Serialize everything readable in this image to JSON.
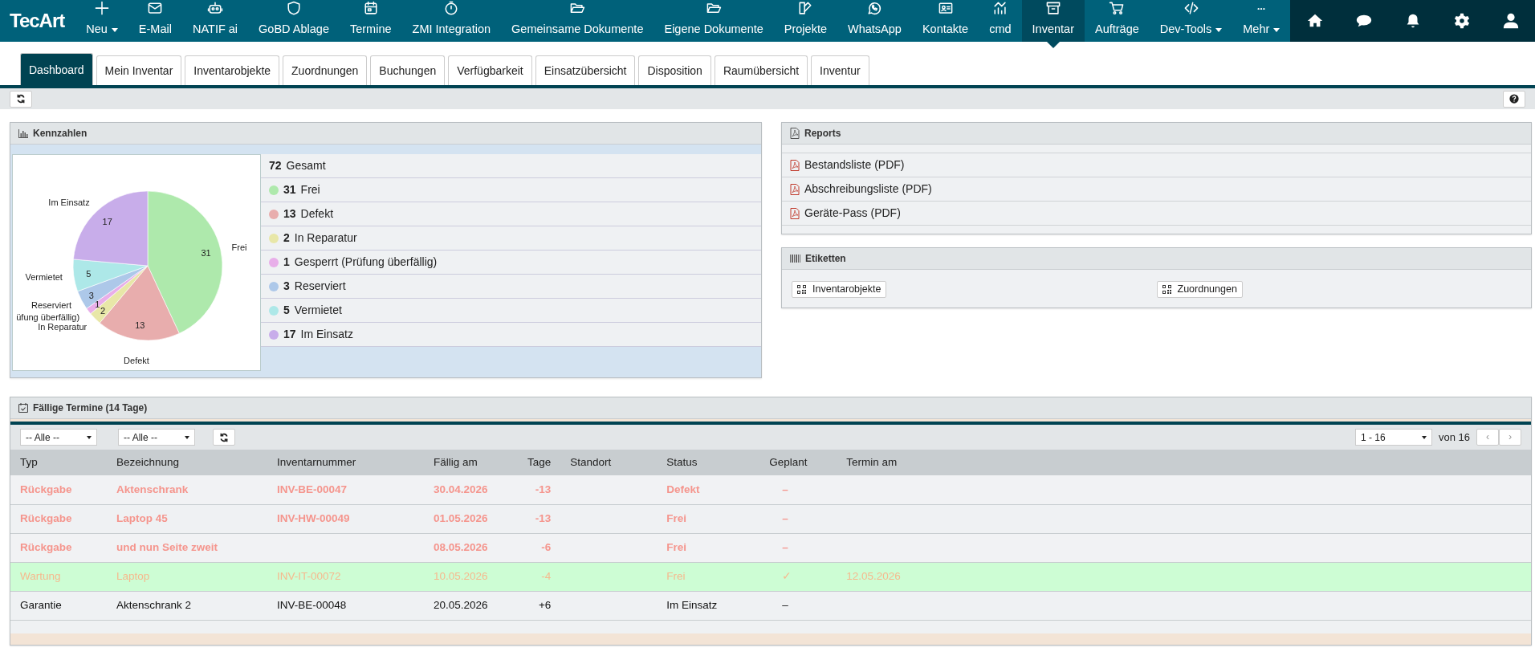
{
  "brand": {
    "name": "TecArt"
  },
  "nav": [
    {
      "label": "Neu",
      "dropdown": true,
      "selected": false
    },
    {
      "label": "E-Mail",
      "dropdown": false,
      "selected": false
    },
    {
      "label": "NATIF ai",
      "dropdown": false,
      "selected": false
    },
    {
      "label": "GoBD Ablage",
      "dropdown": false,
      "selected": false
    },
    {
      "label": "Termine",
      "dropdown": false,
      "selected": false
    },
    {
      "label": "ZMI Integration",
      "dropdown": false,
      "selected": false
    },
    {
      "label": "Gemeinsame Dokumente",
      "dropdown": false,
      "selected": false
    },
    {
      "label": "Eigene Dokumente",
      "dropdown": false,
      "selected": false
    },
    {
      "label": "Projekte",
      "dropdown": false,
      "selected": false
    },
    {
      "label": "WhatsApp",
      "dropdown": false,
      "selected": false
    },
    {
      "label": "Kontakte",
      "dropdown": false,
      "selected": false
    },
    {
      "label": "cmd",
      "dropdown": false,
      "selected": false
    },
    {
      "label": "Inventar",
      "dropdown": false,
      "selected": true
    },
    {
      "label": "Aufträge",
      "dropdown": false,
      "selected": false
    },
    {
      "label": "Dev-Tools",
      "dropdown": true,
      "selected": false
    }
  ],
  "more": {
    "label": "Mehr",
    "dropdown": true
  },
  "tabs": [
    {
      "label": "Dashboard",
      "selected": true
    },
    {
      "label": "Mein Inventar",
      "selected": false
    },
    {
      "label": "Inventarobjekte",
      "selected": false
    },
    {
      "label": "Zuordnungen",
      "selected": false
    },
    {
      "label": "Buchungen",
      "selected": false
    },
    {
      "label": "Verfügbarkeit",
      "selected": false
    },
    {
      "label": "Einsatzübersicht",
      "selected": false
    },
    {
      "label": "Disposition",
      "selected": false
    },
    {
      "label": "Raumübersicht",
      "selected": false
    },
    {
      "label": "Inventur",
      "selected": false
    }
  ],
  "kennzahlen": {
    "title": "Kennzahlen",
    "chart_data": {
      "type": "pie",
      "categories": [
        "Frei",
        "Defekt",
        "In Reparatur",
        "üfung überfällig)",
        "Reserviert",
        "Vermietet",
        "Im Einsatz"
      ],
      "values": [
        31,
        13,
        2,
        1,
        3,
        5,
        17
      ],
      "colors": [
        "#aee9ac",
        "#e8adad",
        "#e8e7a8",
        "#e8aee9",
        "#adc8e9",
        "#ade8e8",
        "#c8adea"
      ],
      "data_labels": true
    },
    "total": {
      "count": "72",
      "label": "Gesamt"
    },
    "legend": [
      {
        "count": "31",
        "label": "Frei",
        "color": "#aee9ac"
      },
      {
        "count": "13",
        "label": "Defekt",
        "color": "#e8adad"
      },
      {
        "count": "2",
        "label": "In Reparatur",
        "color": "#e8e7a8"
      },
      {
        "count": "1",
        "label": "Gesperrt (Prüfung überfällig)",
        "color": "#e8aee9"
      },
      {
        "count": "3",
        "label": "Reserviert",
        "color": "#adc8e9"
      },
      {
        "count": "5",
        "label": "Vermietet",
        "color": "#ade8e8"
      },
      {
        "count": "17",
        "label": "Im Einsatz",
        "color": "#c8adea"
      }
    ]
  },
  "reports": {
    "title": "Reports",
    "items": [
      "Bestandsliste (PDF)",
      "Abschreibungsliste (PDF)",
      "Geräte-Pass (PDF)"
    ]
  },
  "etiketten": {
    "title": "Etiketten",
    "buttons": [
      "Inventarobjekte",
      "Zuordnungen"
    ]
  },
  "termine": {
    "title": "Fällige Termine (14 Tage)",
    "filters": [
      "-- Alle --",
      "-- Alle --"
    ],
    "pager": {
      "range": "1 - 16",
      "of": "von 16",
      "prev": "‹",
      "next": "›"
    },
    "columns": [
      "Typ",
      "Bezeichnung",
      "Inventarnummer",
      "Fällig am",
      "Tage",
      "Standort",
      "Status",
      "Geplant",
      "Termin am"
    ],
    "rows": [
      {
        "kind": "overdue",
        "cells": [
          "Rückgabe",
          "Aktenschrank",
          "INV-BE-00047",
          "30.04.2026",
          "-13",
          "",
          "Defekt",
          "–",
          ""
        ]
      },
      {
        "kind": "overdue",
        "cells": [
          "Rückgabe",
          "Laptop 45",
          "INV-HW-00049",
          "01.05.2026",
          "-13",
          "",
          "Frei",
          "–",
          ""
        ]
      },
      {
        "kind": "overdue",
        "cells": [
          "Rückgabe",
          "und nun Seite zweit",
          "",
          "08.05.2026",
          "-6",
          "",
          "Frei",
          "–",
          ""
        ]
      },
      {
        "kind": "planned",
        "cells": [
          "Wartung",
          "Laptop",
          "INV-IT-00072",
          "10.05.2026",
          "-4",
          "",
          "Frei",
          "✓",
          "12.05.2026"
        ]
      },
      {
        "kind": "normal",
        "cells": [
          "Garantie",
          "Aktenschrank 2",
          "INV-BE-00048",
          "20.05.2026",
          "+6",
          "",
          "Im Einsatz",
          "–",
          ""
        ]
      }
    ]
  }
}
